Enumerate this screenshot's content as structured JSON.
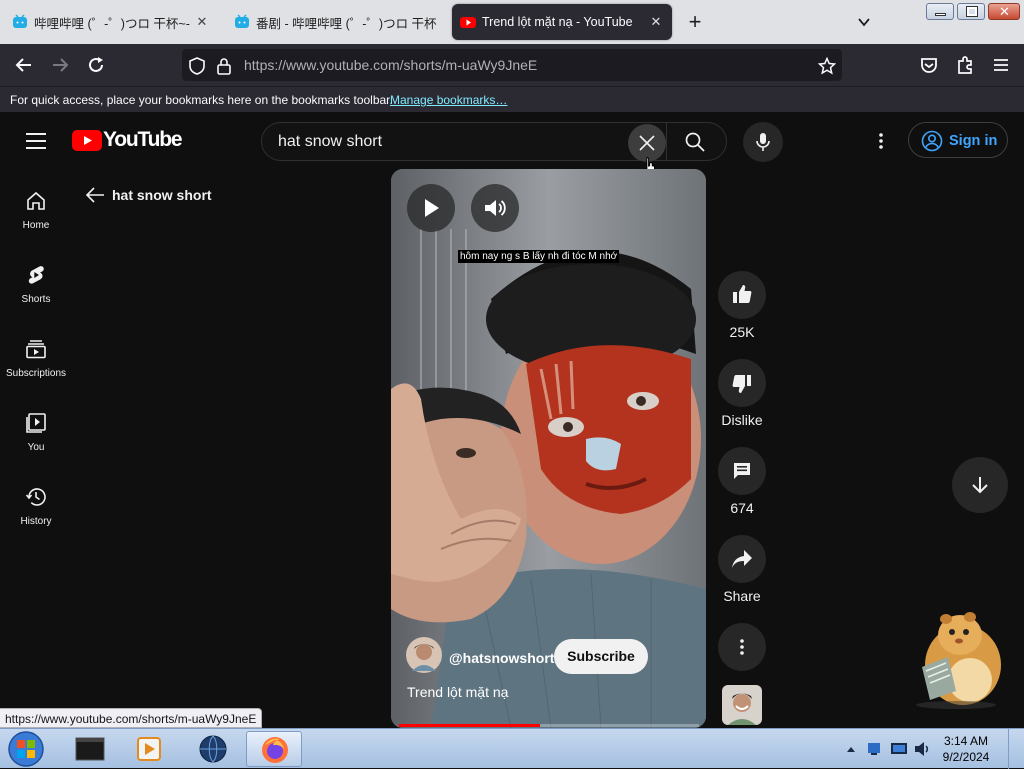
{
  "browser": {
    "tabs": [
      {
        "title": "哔哩哔哩 (゜-゜)つロ 干杯~-bili",
        "active": false
      },
      {
        "title": "番剧 - 哔哩哔哩 (゜-゜)つロ 干杯",
        "active": false
      },
      {
        "title": "Trend lột mặt nạ - YouTube",
        "active": true
      }
    ],
    "new_tab": "+",
    "url_host": "https://www.youtube.com",
    "url_path": "/shorts/m-uaWy9JneE",
    "bookmarks_text": "For quick access, place your bookmarks here on the bookmarks toolbar.",
    "bookmarks_link": "Manage bookmarks…",
    "status_url": "https://www.youtube.com/shorts/m-uaWy9JneE"
  },
  "youtube": {
    "logo_text": "YouTube",
    "search_value": "hat snow short",
    "sign_in": "Sign in",
    "back_title": "hat snow short",
    "sidebar": [
      {
        "label": "Home",
        "icon": "home-icon"
      },
      {
        "label": "Shorts",
        "icon": "shorts-icon"
      },
      {
        "label": "Subscriptions",
        "icon": "subscriptions-icon"
      },
      {
        "label": "You",
        "icon": "you-icon"
      },
      {
        "label": "History",
        "icon": "history-icon"
      }
    ],
    "short": {
      "caption": "hôm nay ng s B lấy nh đi tóc M nhớ",
      "channel": "@hatsnowshort",
      "subscribe": "Subscribe",
      "title": "Trend lột mặt nạ",
      "progress_fraction": 0.47
    },
    "actions": {
      "likes": "25K",
      "dislike": "Dislike",
      "comments": "674",
      "share": "Share"
    },
    "colors": {
      "brand_red": "#ff0000",
      "link_blue": "#3ea6ff",
      "background": "#0f0f0f"
    }
  },
  "taskbar": {
    "time": "3:14 AM",
    "date": "9/2/2024"
  }
}
